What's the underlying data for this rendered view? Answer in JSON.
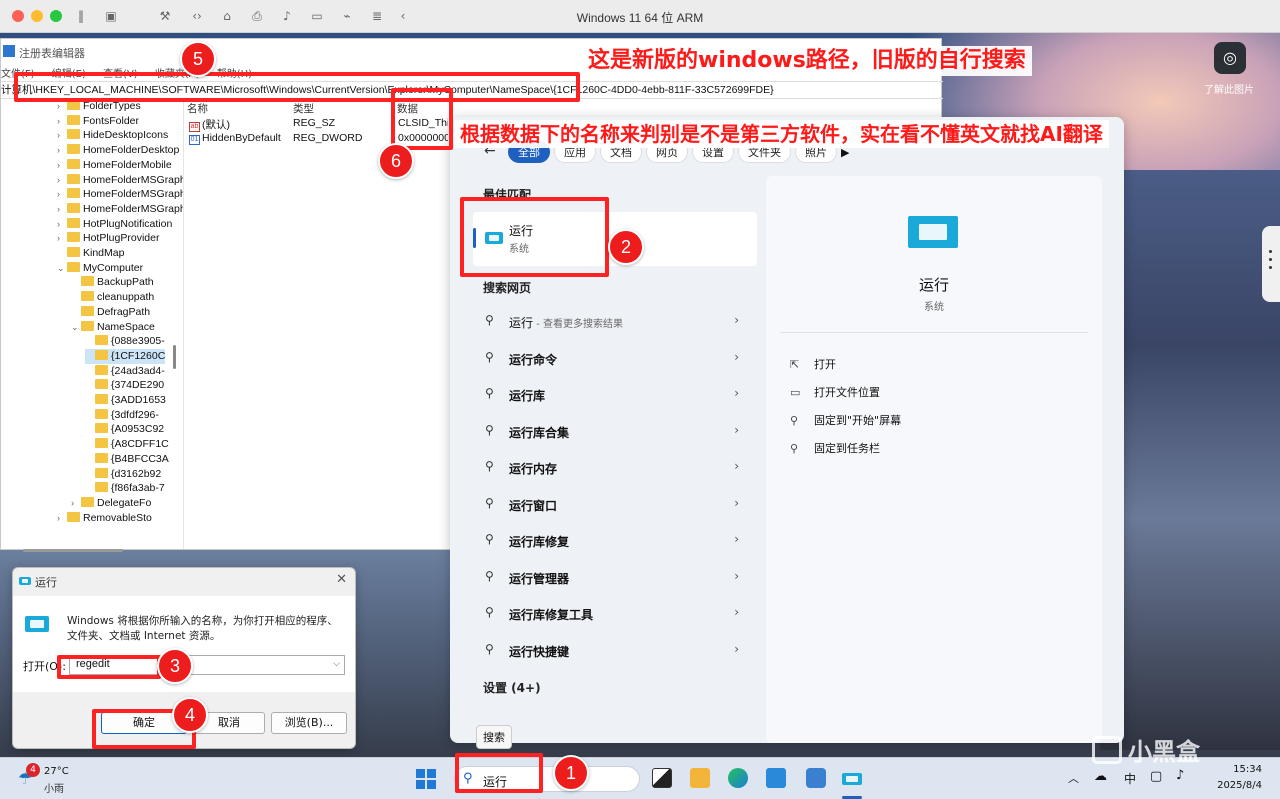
{
  "vm_window": {
    "title": "Windows 11 64 位 ARM",
    "side_label": "了解此图片"
  },
  "regedit": {
    "title": "注册表编辑器",
    "menu": [
      "文件(F)",
      "编辑(E)",
      "查看(V)",
      "收藏夹(A)",
      "帮助(H)"
    ],
    "address": "计算机\\HKEY_LOCAL_MACHINE\\SOFTWARE\\Microsoft\\Windows\\CurrentVersion\\Explorer\\MyComputer\\NameSpace\\{1CF1260C-4DD0-4ebb-811F-33C572699FDE}",
    "tree": [
      {
        "label": "FolderTypes",
        "level": 0,
        "expanded": false
      },
      {
        "label": "FontsFolder",
        "level": 0,
        "expanded": false
      },
      {
        "label": "HideDesktopIcons",
        "level": 0,
        "expanded": false
      },
      {
        "label": "HomeFolderDesktop",
        "level": 0,
        "expanded": false
      },
      {
        "label": "HomeFolderMobile",
        "level": 0,
        "expanded": false
      },
      {
        "label": "HomeFolderMSGraph",
        "level": 0,
        "expanded": false
      },
      {
        "label": "HomeFolderMSGraphFiles",
        "level": 0,
        "expanded": false
      },
      {
        "label": "HomeFolderMSGraphShared",
        "level": 0,
        "expanded": false
      },
      {
        "label": "HotPlugNotification",
        "level": 0,
        "expanded": false
      },
      {
        "label": "HotPlugProvider",
        "level": 0,
        "expanded": false
      },
      {
        "label": "KindMap",
        "level": 0,
        "expanded": null
      },
      {
        "label": "MyComputer",
        "level": 0,
        "expanded": true
      },
      {
        "label": "BackupPath",
        "level": 1,
        "expanded": null
      },
      {
        "label": "cleanuppath",
        "level": 1,
        "expanded": null
      },
      {
        "label": "DefragPath",
        "level": 1,
        "expanded": null
      },
      {
        "label": "NameSpace",
        "level": 1,
        "expanded": true
      },
      {
        "label": "{088e3905-",
        "level": 2,
        "expanded": null
      },
      {
        "label": "{1CF1260C",
        "level": 2,
        "expanded": null,
        "selected": true
      },
      {
        "label": "{24ad3ad4-",
        "level": 2,
        "expanded": null
      },
      {
        "label": "{374DE290",
        "level": 2,
        "expanded": null
      },
      {
        "label": "{3ADD1653",
        "level": 2,
        "expanded": null
      },
      {
        "label": "{3dfdf296-",
        "level": 2,
        "expanded": null
      },
      {
        "label": "{A0953C92",
        "level": 2,
        "expanded": null
      },
      {
        "label": "{A8CDFF1C",
        "level": 2,
        "expanded": null
      },
      {
        "label": "{B4BFCC3A",
        "level": 2,
        "expanded": null
      },
      {
        "label": "{d3162b92",
        "level": 2,
        "expanded": null
      },
      {
        "label": "{f86fa3ab-7",
        "level": 2,
        "expanded": null
      },
      {
        "label": "DelegateFo",
        "level": 1,
        "expanded": false
      },
      {
        "label": "RemovableSto",
        "level": 0,
        "expanded": false
      }
    ],
    "columns": [
      "名称",
      "类型",
      "数据"
    ],
    "values": [
      {
        "name": "(默认)",
        "type": "REG_SZ",
        "data": "CLSID_This"
      },
      {
        "name": "HiddenByDefault",
        "type": "REG_DWORD",
        "data": "0x0000000"
      }
    ]
  },
  "search": {
    "tabs": [
      "全部",
      "应用",
      "文档",
      "网页",
      "设置",
      "文件夹",
      "照片"
    ],
    "best_match_heading": "最佳匹配",
    "best_match": {
      "title": "运行",
      "subtitle": "系统"
    },
    "web_heading": "搜索网页",
    "web_items": [
      {
        "bold": "运行",
        "suffix": " - 查看更多搜索结果"
      },
      {
        "bold": "运行命令",
        "suffix": ""
      },
      {
        "bold": "运行库",
        "suffix": ""
      },
      {
        "bold": "运行库合集",
        "suffix": ""
      },
      {
        "bold": "运行内存",
        "suffix": ""
      },
      {
        "bold": "运行窗口",
        "suffix": ""
      },
      {
        "bold": "运行库修复",
        "suffix": ""
      },
      {
        "bold": "运行管理器",
        "suffix": ""
      },
      {
        "bold": "运行库修复工具",
        "suffix": ""
      },
      {
        "bold": "运行快捷键",
        "suffix": ""
      }
    ],
    "settings_heading": "设置 (4+)",
    "detail": {
      "title": "运行",
      "subtitle": "系统",
      "actions": [
        "打开",
        "打开文件位置",
        "固定到\"开始\"屏幕",
        "固定到任务栏"
      ]
    },
    "tooltip": "搜索"
  },
  "run_dialog": {
    "title": "运行",
    "description": "Windows 将根据你所输入的名称，为你打开相应的程序、文件夹、文档或 Internet 资源。",
    "open_label": "打开(O):",
    "input_value": "regedit",
    "ok": "确定",
    "cancel": "取消",
    "browse": "浏览(B)..."
  },
  "taskbar": {
    "weather_badge": "4",
    "temp": "27°C",
    "condition": "小雨",
    "search_text": "运行",
    "ime": "中",
    "time": "15:34",
    "date": "2025/8/4"
  },
  "annotations": {
    "note_top": "这是新版的windows路径，旧版的自行搜索",
    "note_mid": "根据数据下的名称来判别是不是第三方软件，实在看不懂英文就找AI翻译",
    "badges": [
      "1",
      "2",
      "3",
      "4",
      "5",
      "6"
    ]
  },
  "watermark": "小黑盒",
  "colors": {
    "annotation_red": "#ff1a1a",
    "accent_blue": "#1f5fbf",
    "run_icon": "#1aa9d8"
  }
}
